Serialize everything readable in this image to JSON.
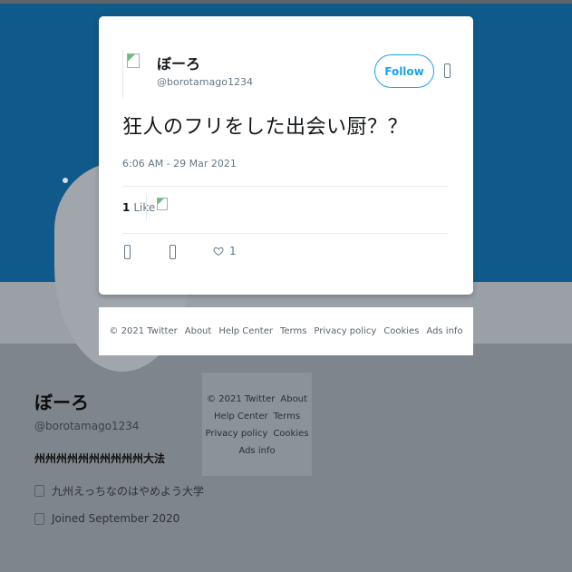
{
  "tweet": {
    "display_name": "ぼーろ",
    "handle": "@borotamago1234",
    "follow_label": "Follow",
    "text": "狂人のフリをした出会い厨？？",
    "timestamp": "6:06 AM - 29 Mar 2021",
    "likes_count": "1",
    "likes_label": "Like",
    "action_like_count": "1"
  },
  "card_footer": {
    "links": [
      "© 2021 Twitter",
      "About",
      "Help Center",
      "Terms",
      "Privacy policy",
      "Cookies",
      "Ads info"
    ]
  },
  "profile": {
    "name": "ぼーろ",
    "handle": "@borotamago1234",
    "bio": "州州州州州州州州州州大法",
    "location": "九州えっちなのはやめよう大学",
    "joined": "Joined September 2020"
  },
  "side_footer": {
    "links": [
      "© 2021 Twitter",
      "About",
      "Help Center",
      "Terms",
      "Privacy policy",
      "Cookies",
      "Ads info"
    ]
  },
  "colors": {
    "banner": "#0f5a8a",
    "accent": "#1da1f2",
    "page_bg": "#7f858c"
  },
  "icons": {
    "more": "more-options-icon",
    "reply": "reply-icon",
    "retweet": "retweet-icon",
    "like": "heart-icon",
    "location": "location-icon",
    "joined": "calendar-icon"
  }
}
